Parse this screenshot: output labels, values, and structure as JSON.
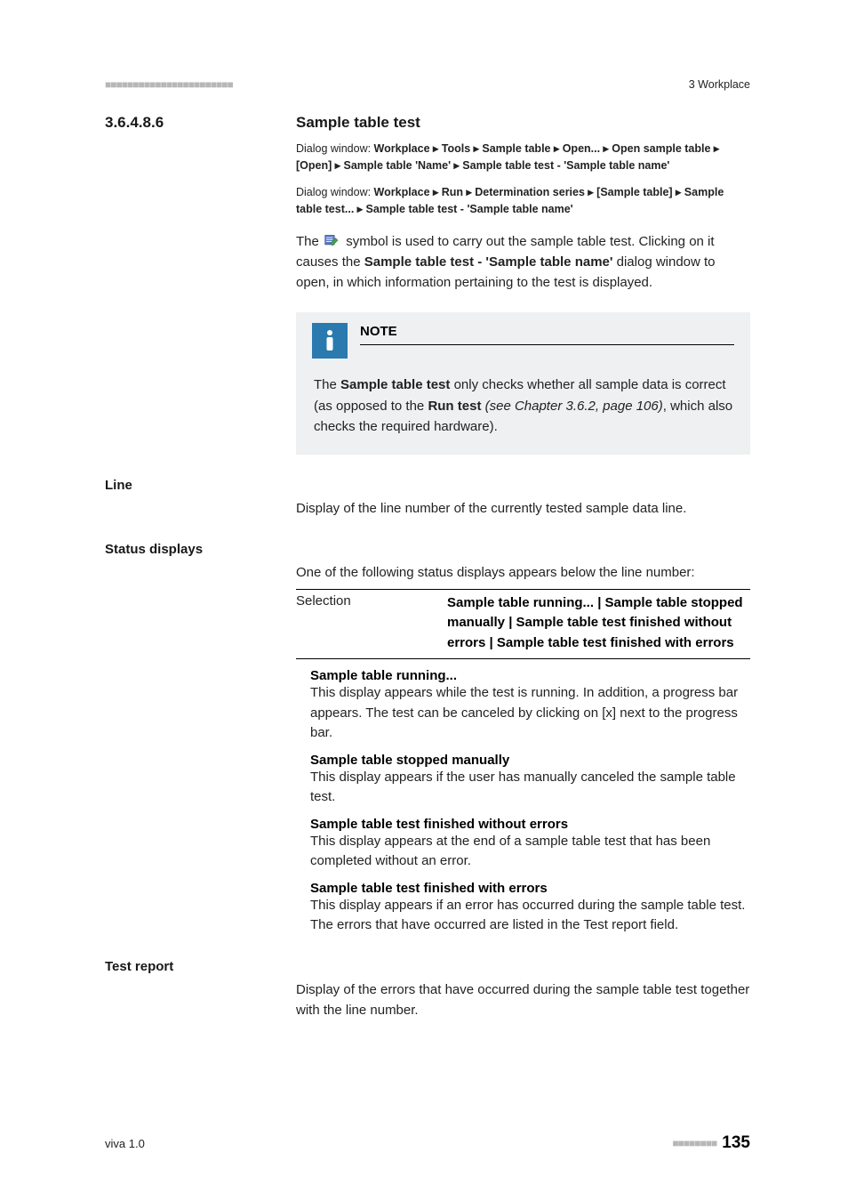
{
  "header": {
    "marks": "■■■■■■■■■■■■■■■■■■■■■■■",
    "right": "3 Workplace"
  },
  "section": {
    "num": "3.6.4.8.6",
    "title": "Sample table test"
  },
  "dialog1": {
    "prefix": "Dialog window: ",
    "path": "Workplace ▸ Tools ▸ Sample table ▸ Open... ▸ Open sample table ▸ [Open] ▸ Sample table 'Name' ▸ Sample table test - 'Sample table name'"
  },
  "dialog2": {
    "prefix": "Dialog window: ",
    "path": "Workplace ▸ Run ▸ Determination series ▸ [Sample table] ▸ Sample table test... ▸ Sample table test - 'Sample table name'"
  },
  "intro": {
    "pre": "The ",
    "mid1": " symbol is used to carry out the sample table test. Clicking on it causes the ",
    "bold": "Sample table test - 'Sample table name'",
    "post": " dialog window to open, in which information pertaining to the test is displayed."
  },
  "note": {
    "title": "NOTE",
    "pre": "The ",
    "b1": "Sample table test",
    "mid": " only checks whether all sample data is correct (as opposed to the ",
    "b2": "Run test",
    "ital": " (see Chapter 3.6.2, page 106)",
    "post": ", which also checks the required hardware)."
  },
  "line": {
    "heading": "Line",
    "text": "Display of the line number of the currently tested sample data line."
  },
  "status": {
    "heading": "Status displays",
    "intro": "One of the following status displays appears below the line number:",
    "sel_label": "Selection",
    "sel_value": "Sample table running... | Sample table stopped manually | Sample table test finished without errors | Sample table test finished with errors",
    "items": [
      {
        "title": "Sample table running...",
        "body": "This display appears while the test is running. In addition, a progress bar appears. The test can be canceled by clicking on [x] next to the progress bar."
      },
      {
        "title": "Sample table stopped manually",
        "body": "This display appears if the user has manually canceled the sample table test."
      },
      {
        "title": "Sample table test finished without errors",
        "body": "This display appears at the end of a sample table test that has been completed without an error."
      },
      {
        "title": "Sample table test finished with errors",
        "body": "This display appears if an error has occurred during the sample table test. The errors that have occurred are listed in the Test report field."
      }
    ],
    "item3_pre": "This display appears if an error has occurred during the sample table test. The errors that have occurred are listed in the ",
    "item3_bold": "Test report",
    "item3_post": " field."
  },
  "testreport": {
    "heading": "Test report",
    "text": "Display of the errors that have occurred during the sample table test together with the line number."
  },
  "footer": {
    "left": "viva 1.0",
    "marks": "■■■■■■■■",
    "page": "135"
  }
}
